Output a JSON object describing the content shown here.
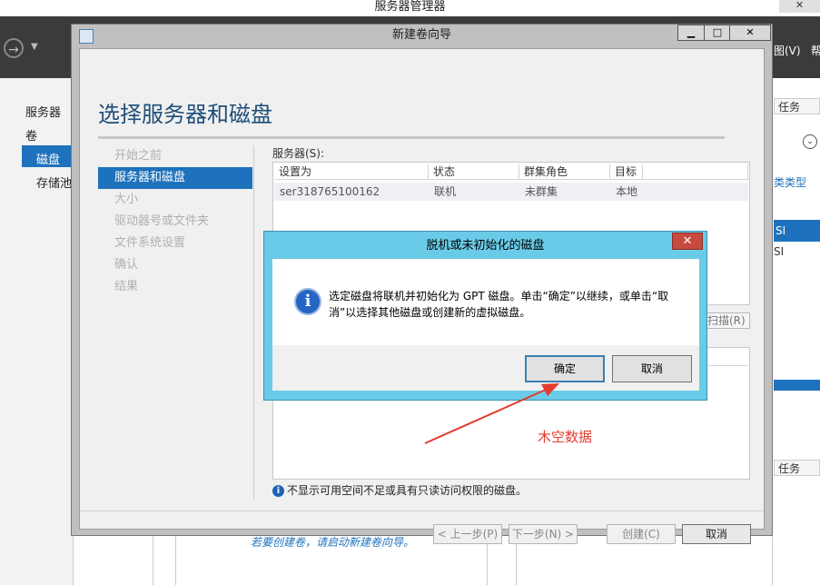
{
  "app": {
    "title": "服务器管理器",
    "menu_view": "图(V)",
    "menu_help": "帮",
    "left_nav": [
      "服务器",
      "卷",
      "磁盘",
      "存储池"
    ],
    "tasks_label": "任务",
    "right_link": "类类型",
    "right_rows": [
      "SI",
      "SI"
    ],
    "bottom_hint": "若要创建卷，请启动新建卷向导。"
  },
  "wizard": {
    "title": "新建卷向导",
    "page_title": "选择服务器和磁盘",
    "steps": [
      "开始之前",
      "服务器和磁盘",
      "大小",
      "驱动器号或文件夹",
      "文件系统设置",
      "确认",
      "结果"
    ],
    "active_step_index": 1,
    "servers_label": "服务器(S):",
    "columns": [
      "设置为",
      "状态",
      "群集角色",
      "目标"
    ],
    "rows": [
      [
        "ser318765100162",
        "联机",
        "未群集",
        "本地"
      ]
    ],
    "rescan_label": "扫描(R)",
    "note": "不显示可用空间不足或具有只读访问权限的磁盘。",
    "buttons": {
      "prev": "< 上一步(P)",
      "next": "下一步(N) >",
      "create": "创建(C)",
      "cancel": "取消"
    }
  },
  "dialog": {
    "title": "脱机或未初始化的磁盘",
    "message": "选定磁盘将联机并初始化为 GPT 磁盘。单击“确定”以继续，或单击“取消”以选择其他磁盘或创建新的虚拟磁盘。",
    "ok": "确定",
    "cancel": "取消"
  },
  "annotation": {
    "text": "木空数据",
    "color": "#e63b2e"
  },
  "colors": {
    "accent": "#1e72bd",
    "dialog_frame": "#6acbe8",
    "close_red": "#c74a3e"
  },
  "icons": {
    "info": "info-icon",
    "back": "back-arrow-icon"
  }
}
